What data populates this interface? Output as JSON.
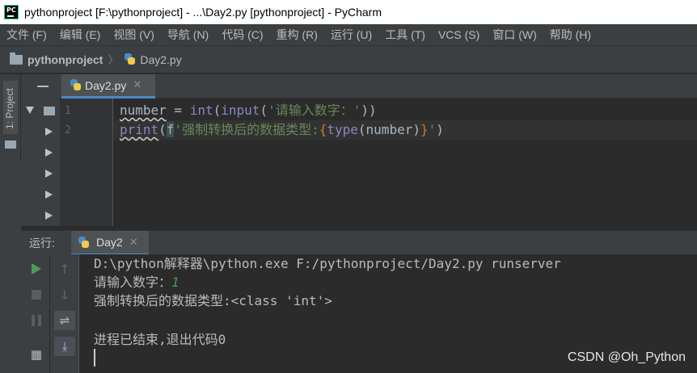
{
  "window": {
    "title": "pythonproject [F:\\pythonproject] - ...\\Day2.py [pythonproject] - PyCharm",
    "app_icon_text": "PC"
  },
  "menu": [
    {
      "label": "文件 (F)"
    },
    {
      "label": "编辑 (E)"
    },
    {
      "label": "视图 (V)"
    },
    {
      "label": "导航 (N)"
    },
    {
      "label": "代码 (C)"
    },
    {
      "label": "重构 (R)"
    },
    {
      "label": "运行 (U)"
    },
    {
      "label": "工具 (T)"
    },
    {
      "label": "VCS (S)"
    },
    {
      "label": "窗口 (W)"
    },
    {
      "label": "帮助 (H)"
    }
  ],
  "breadcrumb": {
    "project": "pythonproject",
    "file": "Day2.py"
  },
  "side_tool": {
    "project_label": "1: Project"
  },
  "editor": {
    "tab_label": "Day2.py",
    "tab_close": "✕",
    "line_numbers": [
      "1",
      "2"
    ],
    "line1": {
      "var": "number",
      "eq": " = ",
      "fn1": "int",
      "p1": "(",
      "fn2": "input",
      "p2": "(",
      "str": "'请输入数字：'",
      "p3": "))"
    },
    "line2": {
      "fn": "print",
      "p1": "(",
      "fprefix": "f",
      "str1": "'强制转换后的数据类型:",
      "brace_open": "{",
      "fn2": "type",
      "arg": "(number)",
      "brace_close": "}",
      "str2": "'",
      "p2": ")"
    }
  },
  "run": {
    "label": "运行:",
    "tab_label": "Day2",
    "tab_close": "✕",
    "console": {
      "cmd": "D:\\python解释器\\python.exe F:/pythonproject/Day2.py runserver",
      "prompt": "请输入数字：",
      "input": "1",
      "output": "强制转换后的数据类型:<class 'int'>",
      "exit": "进程已结束,退出代码0"
    }
  },
  "watermark": "CSDN @Oh_Python",
  "colors": {
    "accent": "#4a88c7",
    "run_green": "#499c54",
    "editor_bg": "#2b2b2b",
    "panel_bg": "#3c3f41"
  }
}
